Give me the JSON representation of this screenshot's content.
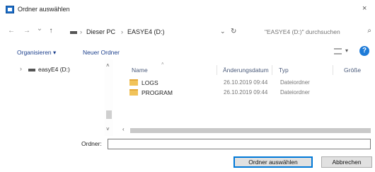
{
  "window": {
    "title": "Ordner auswählen",
    "close_glyph": "×",
    "icon": "folder-dialog-icon"
  },
  "navigation": {
    "back_glyph": "←",
    "forward_glyph": "→",
    "history_glyph": "⌄",
    "up_glyph": "↑",
    "breadcrumbs": [
      "Dieser PC",
      "EASYE4 (D:)"
    ],
    "crumb_separator": "›",
    "dropdown_glyph": "⌄",
    "refresh_glyph": "↻",
    "search_placeholder": "\"EASYE4 (D:)\" durchsuchen",
    "search_icon_glyph": "⌕"
  },
  "toolbar": {
    "organize_label": "Organisieren ▾",
    "new_folder_label": "Neuer Ordner",
    "view_dropdown_glyph": "▾",
    "help_glyph": "?"
  },
  "nav_pane": {
    "items": [
      {
        "chevron": "›",
        "label": "easyE4 (D:)",
        "icon": "drive-icon"
      }
    ],
    "scroll_up_glyph": "˄",
    "scroll_down_glyph": "˅"
  },
  "file_list": {
    "columns": {
      "name": "Name",
      "modified": "Änderungsdatum",
      "type": "Typ",
      "size": "Größe"
    },
    "sort_glyph": "˄",
    "rows": [
      {
        "name": "LOGS",
        "modified": "26.10.2019 09:44",
        "type": "Dateiordner",
        "icon": "folder-icon"
      },
      {
        "name": "PROGRAM",
        "modified": "26.10.2019 09:44",
        "type": "Dateiordner",
        "icon": "folder-icon"
      }
    ],
    "hscroll_left_glyph": "‹"
  },
  "folder_field": {
    "label": "Ordner:",
    "value": ""
  },
  "buttons": {
    "select_folder": "Ordner auswählen",
    "cancel": "Abbrechen"
  },
  "colors": {
    "accent": "#0078d7",
    "link": "#1b3f8c",
    "folder": "#f1c35a"
  }
}
